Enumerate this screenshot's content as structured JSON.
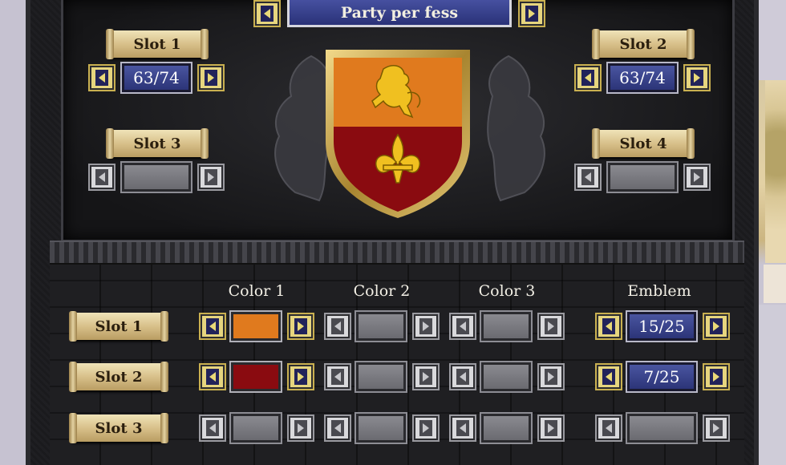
{
  "header": {
    "division_label": "Party per fess"
  },
  "shield_slots": [
    {
      "label": "Slot 1",
      "value": "63/74",
      "active": true
    },
    {
      "label": "Slot 2",
      "value": "63/74",
      "active": true
    },
    {
      "label": "Slot 3",
      "value": "",
      "active": false
    },
    {
      "label": "Slot 4",
      "value": "",
      "active": false
    }
  ],
  "columns": [
    "Color 1",
    "Color 2",
    "Color 3",
    "Emblem"
  ],
  "rows": [
    {
      "label": "Slot 1",
      "color1": "#e07a1e",
      "color1_active": true,
      "color2_active": false,
      "color3_active": false,
      "emblem": "15/25",
      "emblem_active": true
    },
    {
      "label": "Slot 2",
      "color1": "#8a0b10",
      "color1_active": true,
      "color2_active": false,
      "color3_active": false,
      "emblem": "7/25",
      "emblem_active": true
    },
    {
      "label": "Slot 3",
      "color1": "",
      "color1_active": false,
      "color2_active": false,
      "color3_active": false,
      "emblem": "",
      "emblem_active": false
    }
  ],
  "shield": {
    "top_color": "#e07a1e",
    "bottom_color": "#8a0b10",
    "charge_top": "lion-rampant-icon",
    "charge_bottom": "fleur-de-lis-icon",
    "charge_color": "#f0c020"
  }
}
